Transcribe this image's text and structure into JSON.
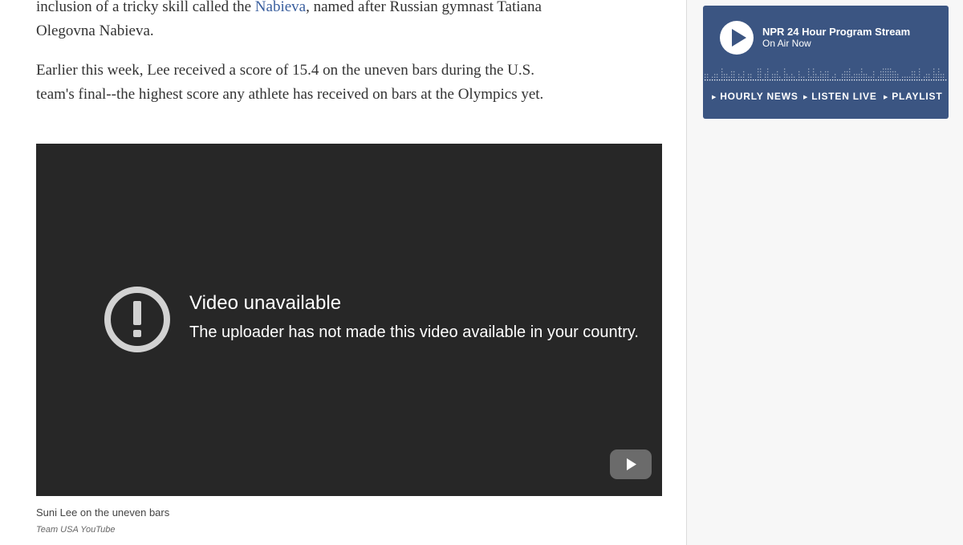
{
  "article": {
    "para1_line1_before": "inclusion of a tricky skill called the ",
    "para1_link": "Nabieva",
    "para1_line1_after": ", named after Russian gymnast Tatiana",
    "para1_line2": "Olegovna Nabieva.",
    "para2_line1": "Earlier this week, Lee received a score of 15.4 on the uneven bars during the U.S.",
    "para2_line2": "team's final--the highest score any athlete has received on bars at the Olympics yet.",
    "link_color": "#3a5f9e"
  },
  "video": {
    "title": "Video unavailable",
    "message": "The uploader has not made this video available in your country.",
    "icon": "alert-circle-icon",
    "play_icon": "youtube-play-icon",
    "background": "#272727"
  },
  "caption": {
    "text": "Suni Lee on the uneven bars",
    "credit": "Team USA YouTube"
  },
  "player": {
    "stream_title": "NPR 24 Hour Program Stream",
    "status": "On Air Now",
    "background": "#3b5582",
    "play_icon": "play-icon",
    "nav": [
      {
        "label": "HOURLY NEWS"
      },
      {
        "label": "LISTEN LIVE"
      },
      {
        "label": "PLAYLIST"
      }
    ]
  }
}
